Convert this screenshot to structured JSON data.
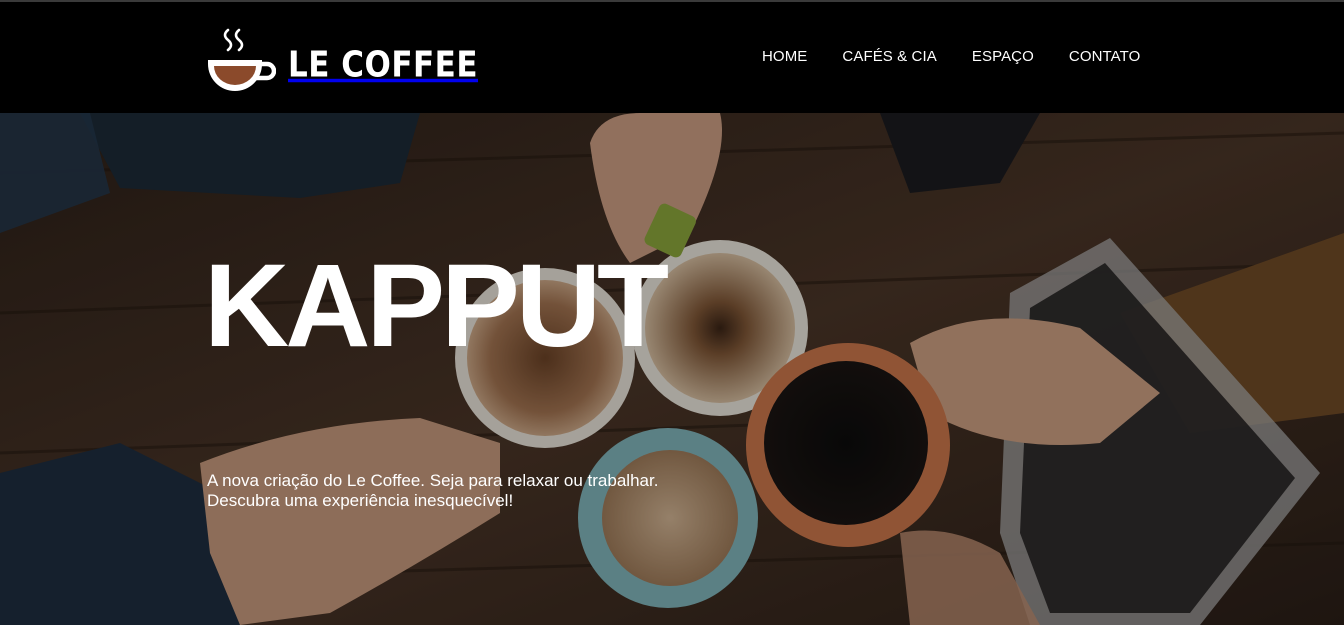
{
  "brand": {
    "name": "LE COFFEE",
    "logo_icon": "coffee-cup-icon",
    "accent": "#8b4a2b"
  },
  "nav": {
    "items": [
      {
        "label": "HOME"
      },
      {
        "label": "CAFÉS & CIA"
      },
      {
        "label": "ESPAÇO"
      },
      {
        "label": "CONTATO"
      }
    ]
  },
  "hero": {
    "title": "KAPPUT",
    "subtitle_line1": "A nova criação do Le Coffee. Seja para relaxar ou trabalhar.",
    "subtitle_line2": "Descubra uma experiência inesquecível!"
  }
}
